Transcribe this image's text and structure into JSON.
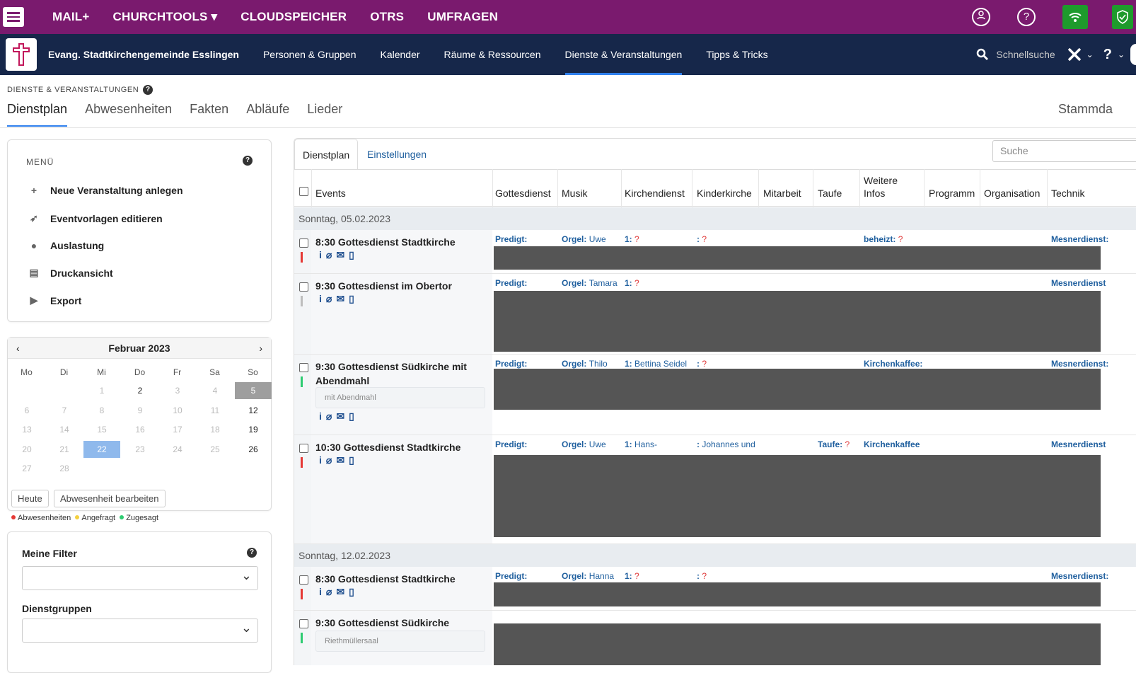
{
  "topbar": {
    "links": [
      "MAIL+",
      "CHURCHTOOLS ▾",
      "CLOUDSPEICHER",
      "OTRS",
      "UMFRAGEN"
    ],
    "icons": [
      "user-circle-icon",
      "help-circle-icon",
      "wifi-icon",
      "shield-check-icon"
    ],
    "colors": {
      "bar": "#7a1a6e",
      "green": "#1e9a2c"
    }
  },
  "navbar": {
    "org": "Evang. Stadtkirchengemeinde Esslingen",
    "links": [
      "Personen & Gruppen",
      "Kalender",
      "Räume & Ressourcen",
      "Dienste & Veranstaltungen",
      "Tipps & Tricks"
    ],
    "active": "Dienste & Veranstaltungen",
    "search": "Schnellsuche"
  },
  "breadcrumb": "DIENSTE & VERANSTALTUNGEN",
  "tabs": [
    "Dienstplan",
    "Abwesenheiten",
    "Fakten",
    "Abläufe",
    "Lieder"
  ],
  "tabs_right": "Stammda",
  "menu": {
    "title": "MENÜ",
    "items": [
      "Neue Veranstaltung anlegen",
      "Eventvorlagen editieren",
      "Auslastung",
      "Druckansicht",
      "Export"
    ]
  },
  "calendar": {
    "month": "Februar 2023",
    "dows": [
      "Mo",
      "Di",
      "Mi",
      "Do",
      "Fr",
      "Sa",
      "So"
    ],
    "weeks": [
      [
        "",
        "",
        "1",
        "2",
        "3",
        "4",
        "5"
      ],
      [
        "6",
        "7",
        "8",
        "9",
        "10",
        "11",
        "12"
      ],
      [
        "13",
        "14",
        "15",
        "16",
        "17",
        "18",
        "19"
      ],
      [
        "20",
        "21",
        "22",
        "23",
        "24",
        "25",
        "26"
      ],
      [
        "27",
        "28",
        "",
        "",
        "",
        "",
        ""
      ]
    ],
    "btn_today": "Heute",
    "btn_absence": "Abwesenheit bearbeiten"
  },
  "legend": [
    "Abwesenheiten",
    "Angefragt",
    "Zugesagt"
  ],
  "filters": {
    "mine": "Meine Filter",
    "groups": "Dienstgruppen"
  },
  "main": {
    "tabs": [
      "Dienstplan",
      "Einstellungen"
    ],
    "search_placeholder": "Suche",
    "headers": [
      "Events",
      "Gottesdienst",
      "Musik",
      "Kirchendienst",
      "Kinderkirche",
      "Mitarbeit",
      "Taufe",
      "Weitere Infos",
      "Programm",
      "Organisation",
      "Technik"
    ],
    "dates": [
      "Sonntag, 05.02.2023",
      "Sonntag, 12.02.2023"
    ],
    "events": [
      {
        "title": "8:30 Gottesdienst Stadtkirche",
        "note": "",
        "cells": {
          "gd": "Predigt:",
          "mu_l": "Orgel:",
          "mu_v": "Uwe",
          "kd_l": "1:",
          "kd_v": "?",
          "kk_l": ":",
          "kk_v": "?",
          "ta_l": "",
          "ta_v": "",
          "wi_l": "beheizt:",
          "wi_v": "?",
          "te": "Mesnerdienst:"
        }
      },
      {
        "title": "9:30 Gottesdienst im Obertor",
        "note": "",
        "cells": {
          "gd": "Predigt:",
          "mu_l": "Orgel:",
          "mu_v": "Tamara",
          "kd_l": "1:",
          "kd_v": "?",
          "kk_l": "",
          "kk_v": "",
          "ta_l": "",
          "ta_v": "",
          "wi_l": "",
          "wi_v": "",
          "te": "Mesnerdienst"
        }
      },
      {
        "title": "9:30 Gottesdienst Südkirche mit Abendmahl",
        "note": "mit Abendmahl",
        "cells": {
          "gd": "Predigt:",
          "mu_l": "Orgel:",
          "mu_v": "Thilo",
          "kd_l": "1:",
          "kd_v": "Bettina Seidel",
          "kk_l": ":",
          "kk_v": "?",
          "ta_l": "",
          "ta_v": "",
          "wi_l": "Kirchenkaffee:",
          "wi_v": "",
          "te": "Mesnerdienst:"
        }
      },
      {
        "title": "10:30 Gottesdienst Stadtkirche",
        "note": "",
        "cells": {
          "gd": "Predigt:",
          "mu_l": "Orgel:",
          "mu_v": "Uwe",
          "kd_l": "1:",
          "kd_v": "Hans-",
          "kk_l": ":",
          "kk_v": "Johannes und",
          "ta_l": "Taufe:",
          "ta_v": "?",
          "wi_l": "Kirchenkaffee",
          "wi_v": "",
          "te": "Mesnerdienst"
        }
      },
      {
        "title": "8:30 Gottesdienst Stadtkirche",
        "note": "",
        "cells": {
          "gd": "Predigt:",
          "mu_l": "Orgel:",
          "mu_v": "Hanna",
          "kd_l": "1:",
          "kd_v": "?",
          "kk_l": ":",
          "kk_v": "?",
          "ta_l": "",
          "ta_v": "",
          "wi_l": "",
          "wi_v": "",
          "te": "Mesnerdienst:"
        }
      },
      {
        "title": "9:30 Gottesdienst Südkirche",
        "note": "Riethmüllersaal",
        "cells": {
          "gd": "",
          "mu_l": "",
          "mu_v": "",
          "kd_l": "",
          "kd_v": "",
          "kk_l": "",
          "kk_v": "",
          "ta_l": "",
          "ta_v": "",
          "wi_l": "",
          "wi_v": "",
          "te": ""
        }
      }
    ],
    "status_colors": {
      "red": "#e53935",
      "gray": "#bdbdbd",
      "green": "#2ecc71"
    }
  }
}
